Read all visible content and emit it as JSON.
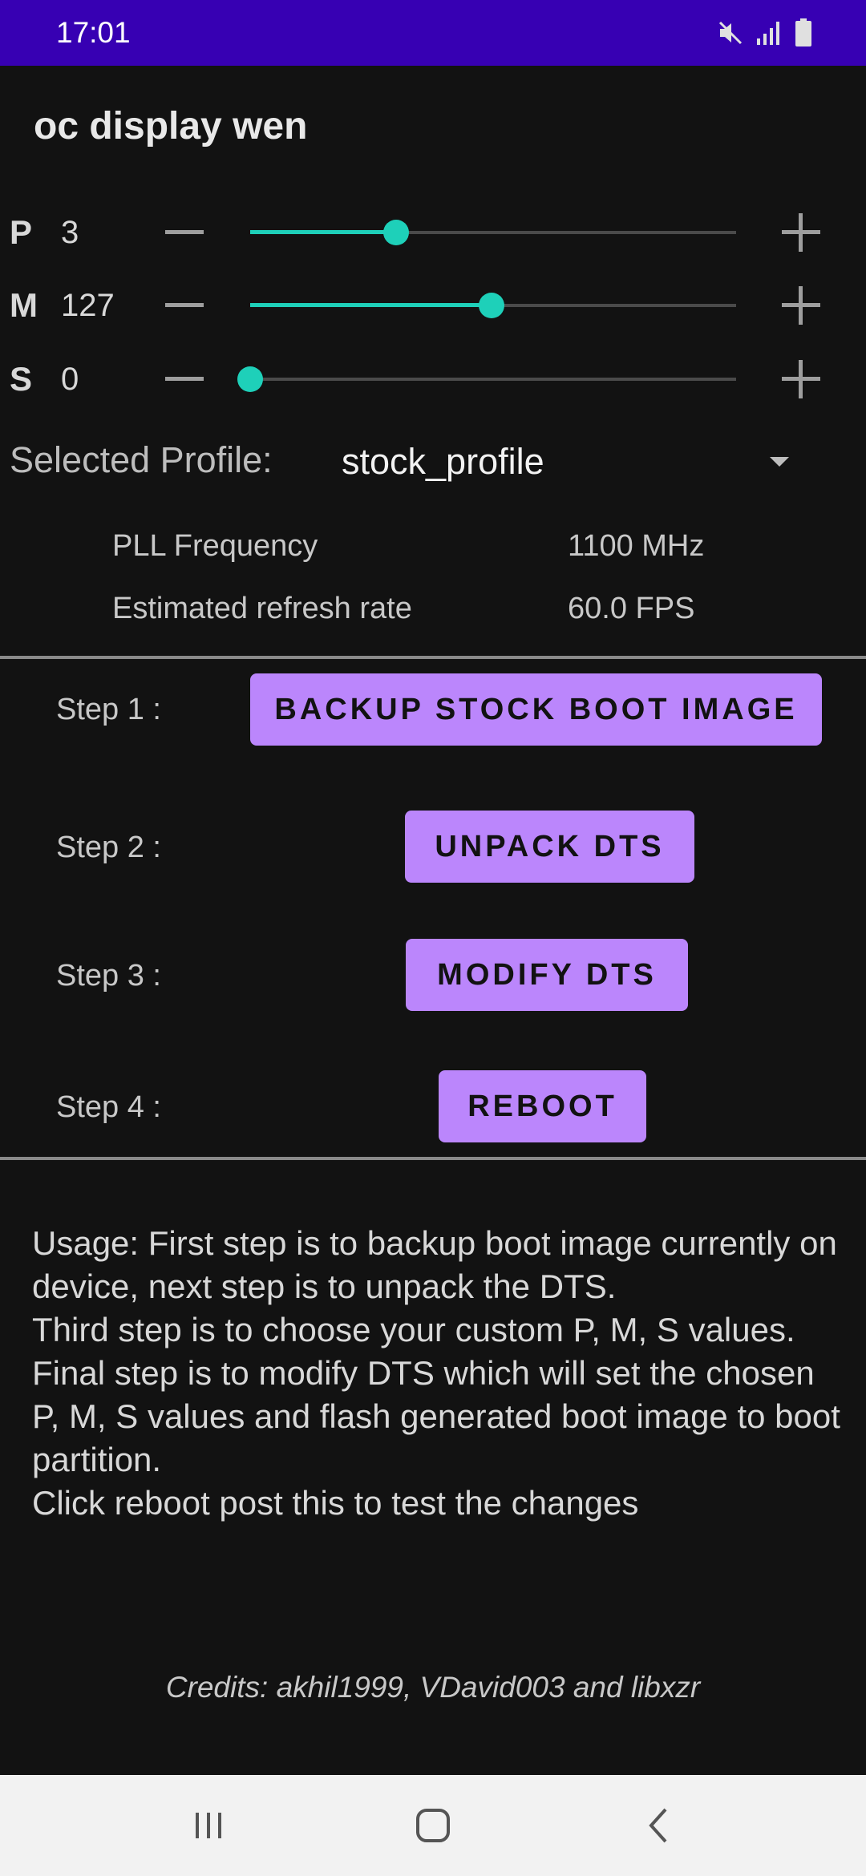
{
  "status_bar": {
    "time": "17:01",
    "icons": [
      "mute-icon",
      "signal-icon",
      "battery-icon"
    ],
    "background": "#3700b3"
  },
  "app": {
    "title": "oc display wen"
  },
  "pms": [
    {
      "letter": "P",
      "value": "3",
      "fraction": 0.3
    },
    {
      "letter": "M",
      "value": "127",
      "fraction": 0.496
    },
    {
      "letter": "S",
      "value": "0",
      "fraction": 0.0
    }
  ],
  "profile": {
    "label": "Selected Profile:",
    "value": "stock_profile"
  },
  "info": {
    "pll_label": "PLL Frequency",
    "pll_value": "1100 MHz",
    "refresh_label": "Estimated refresh rate",
    "refresh_value": "60.0 FPS"
  },
  "steps": [
    {
      "label": "Step 1 :",
      "button": "BACKUP STOCK BOOT IMAGE"
    },
    {
      "label": "Step 2 :",
      "button": "UNPACK DTS"
    },
    {
      "label": "Step 3 :",
      "button": "MODIFY DTS"
    },
    {
      "label": "Step 4 :",
      "button": "REBOOT"
    }
  ],
  "usage": {
    "line1": "Usage: First step is to backup boot image currently on device, next step is to unpack the DTS.",
    "line2": "Third step is to choose your custom P, M, S values.",
    "line3": "Final step is to modify DTS which will set the chosen P, M, S values and flash generated boot image to boot partition.",
    "line4": "Click reboot post this to test the changes"
  },
  "credits": "Credits: akhil1999, VDavid003 and libxzr",
  "colors": {
    "accent": "#1ed0b9",
    "button": "#bb86fc",
    "background": "#121212"
  },
  "nav": {
    "icons": [
      "recents-icon",
      "home-icon",
      "back-icon"
    ]
  }
}
